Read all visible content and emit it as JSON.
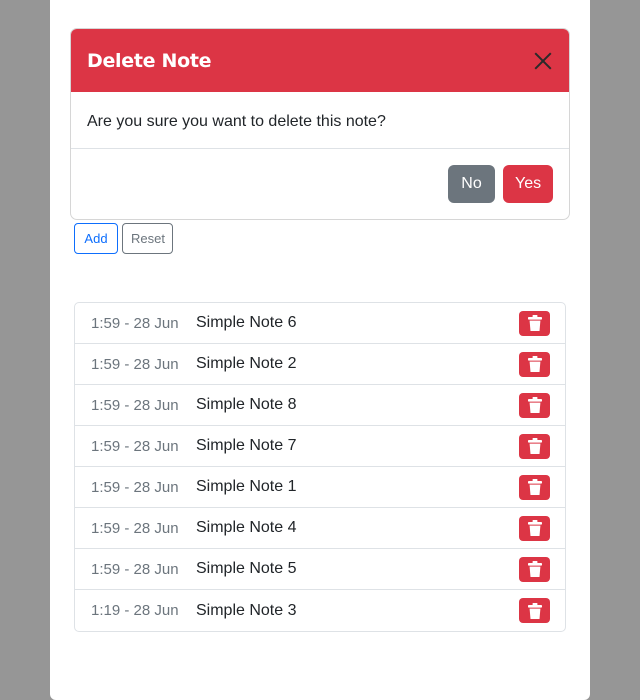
{
  "modal": {
    "title": "Delete Note",
    "message": "Are you sure you want to delete this note?",
    "no_label": "No",
    "yes_label": "Yes",
    "close_icon": "close-icon"
  },
  "toolbar": {
    "add_label": "Add",
    "reset_label": "Reset"
  },
  "notes": [
    {
      "time": "1:59 - 28 Jun",
      "text": "Simple Note 6"
    },
    {
      "time": "1:59 - 28 Jun",
      "text": "Simple Note 2"
    },
    {
      "time": "1:59 - 28 Jun",
      "text": "Simple Note 8"
    },
    {
      "time": "1:59 - 28 Jun",
      "text": "Simple Note 7"
    },
    {
      "time": "1:59 - 28 Jun",
      "text": "Simple Note 1"
    },
    {
      "time": "1:59 - 28 Jun",
      "text": "Simple Note 4"
    },
    {
      "time": "1:59 - 28 Jun",
      "text": "Simple Note 5"
    },
    {
      "time": "1:19 - 28 Jun",
      "text": "Simple Note 3"
    }
  ],
  "colors": {
    "danger": "#dc3545",
    "secondary": "#6c757d",
    "primary": "#0d6efd",
    "backdrop": "#969696"
  }
}
